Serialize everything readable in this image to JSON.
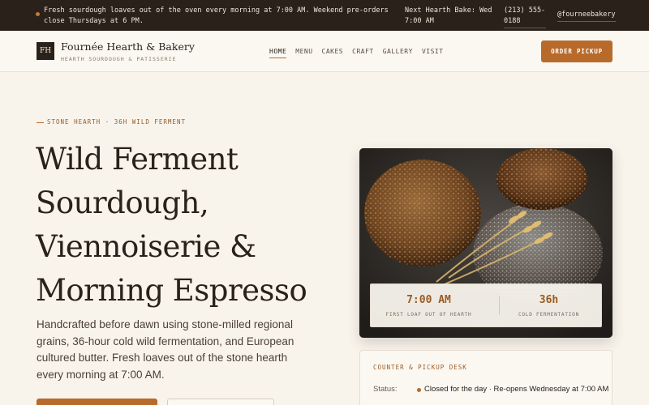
{
  "announcement": {
    "message": "Fresh sourdough loaves out of the oven every morning at 7:00 AM. Weekend pre-orders close Thursdays at 6 PM.",
    "next_bake": "Next Hearth Bake: Wed 7:00 AM",
    "phone": "(213) 555-0188",
    "social": "@fourneebakery"
  },
  "header": {
    "logo_mark": "FH",
    "brand_name": "Fournée Hearth & Bakery",
    "brand_tagline": "HEARTH SOURDOUGH & PATISSERIE",
    "nav": [
      "HOME",
      "MENU",
      "CAKES",
      "CRAFT",
      "GALLERY",
      "VISIT"
    ],
    "active_nav": "HOME",
    "order_button": "ORDER PICKUP"
  },
  "hero": {
    "eyebrow": "STONE HEARTH · 36H WILD FERMENT",
    "headline": "Wild Ferment Sourdough, Viennoiserie & Morning Espresso",
    "lede": "Handcrafted before dawn using stone-milled regional grains, 36-hour cold wild fermentation, and European cultured butter. Fresh loaves out of the stone hearth every morning at 7:00 AM."
  },
  "stats": [
    {
      "value": "7:00 AM",
      "label": "FIRST LOAF OUT OF HEARTH"
    },
    {
      "value": "36h",
      "label": "COLD FERMENTATION"
    }
  ],
  "counter": {
    "title": "COUNTER & PICKUP DESK",
    "status_label": "Status:",
    "status_value": "Closed for the day · Re-opens Wednesday at 7:00 AM"
  },
  "colors": {
    "accent": "#b86a2a",
    "dark": "#2a211a",
    "background": "#f8f4ec"
  }
}
